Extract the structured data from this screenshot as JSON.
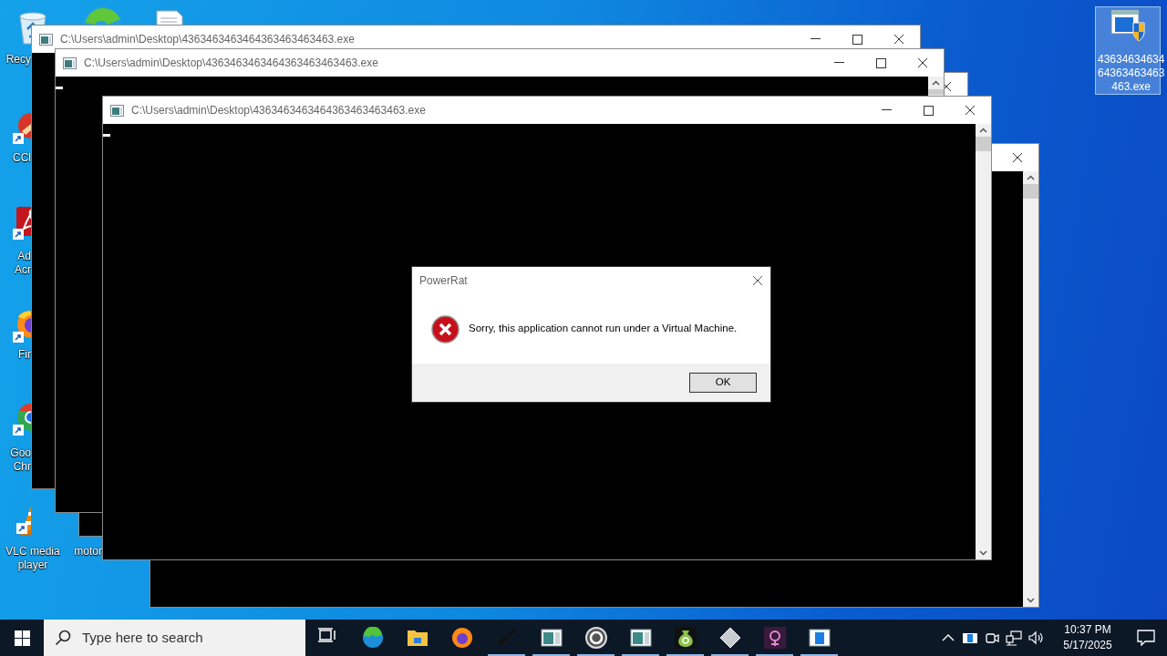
{
  "desktop_icons": [
    {
      "kind": "recycle-bin",
      "label_lines": [
        "Recy"
      ],
      "selected": false
    },
    {
      "kind": "edge",
      "selected": false
    },
    {
      "kind": "document",
      "selected": false
    },
    {
      "kind": "cleaner",
      "label_lines": [
        "CCl"
      ],
      "selected": false
    },
    {
      "kind": "acrobat",
      "label_lines": [
        "Ad",
        "Acr"
      ],
      "selected": false
    },
    {
      "kind": "firefox",
      "label_lines": [
        "Fir"
      ],
      "selected": false
    },
    {
      "kind": "chrome",
      "label_lines": [
        "Goo",
        "Chr"
      ],
      "selected": false
    },
    {
      "kind": "vlc",
      "label_lines": [
        "VLC media player"
      ],
      "selected": false
    },
    {
      "kind": "hidden",
      "label_lines": [
        "motor"
      ],
      "selected": false
    },
    {
      "kind": "exe",
      "label_lines": [
        "4363463463464363463463463.exe"
      ],
      "selected": true
    }
  ],
  "windows": [
    {
      "title": "C:\\Users\\admin\\Desktop\\4363463463464363463463463.exe",
      "cursor": false
    },
    {
      "title": "C:\\Users\\admin\\Desktop\\4363463463464363463463463.exe",
      "cursor": true
    },
    {
      "cursor": false
    },
    {
      "cursor": false
    },
    {
      "title": "C:\\Users\\admin\\Desktop\\4363463463464363463463463.exe",
      "cursor": true
    }
  ],
  "dialog": {
    "title": "PowerRat",
    "message": "Sorry, this application cannot run under a Virtual Machine.",
    "button": "OK"
  },
  "taskbar": {
    "search_placeholder": "Type here to search",
    "apps": [
      {
        "kind": "task-view",
        "running": false
      },
      {
        "kind": "edge",
        "running": false
      },
      {
        "kind": "folder",
        "running": false
      },
      {
        "kind": "firefox",
        "running": false
      },
      {
        "kind": "chain",
        "running": true
      },
      {
        "kind": "console",
        "running": true
      },
      {
        "kind": "disc",
        "running": true
      },
      {
        "kind": "console",
        "running": true
      },
      {
        "kind": "money-bag",
        "running": true
      },
      {
        "kind": "diamond",
        "running": true
      },
      {
        "kind": "orb",
        "running": true
      },
      {
        "kind": "app-window",
        "running": true
      }
    ],
    "time": "10:37 PM",
    "date": "5/17/2025"
  }
}
